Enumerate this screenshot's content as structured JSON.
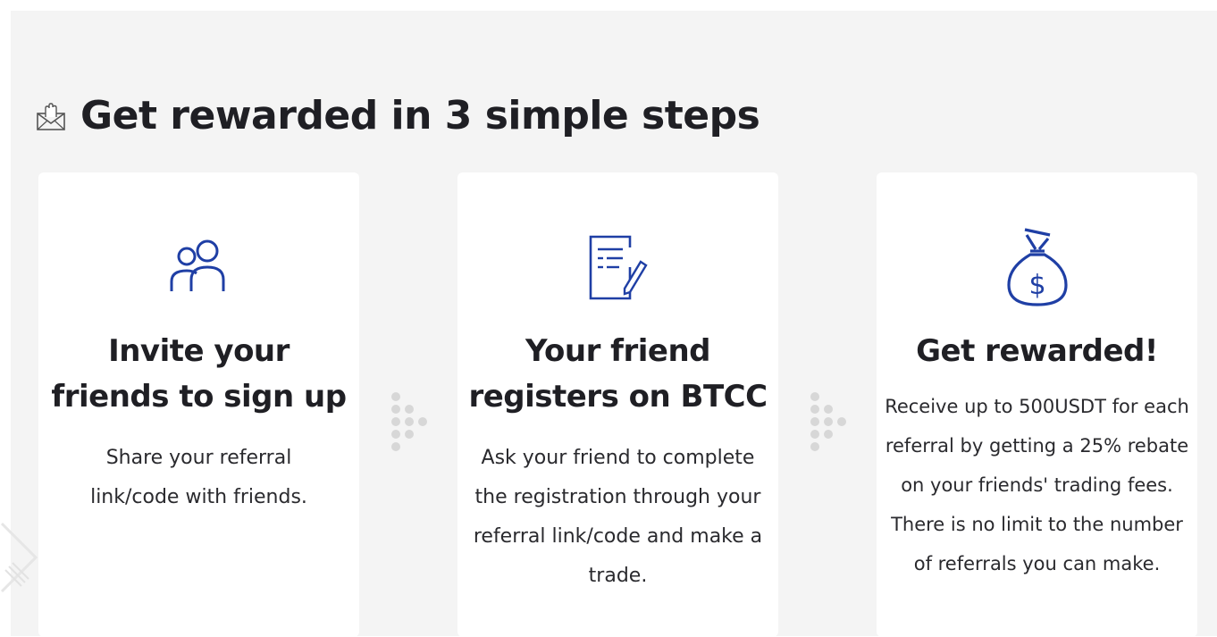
{
  "section": {
    "title": "Get rewarded in 3 simple steps",
    "title_icon": "hand-envelope-icon"
  },
  "colors": {
    "background": "#f4f4f4",
    "card": "#ffffff",
    "icon_blue": "#1f3fa5",
    "dots": "#d7d7d7",
    "text": "#1f1f24"
  },
  "steps": [
    {
      "icon": "users-icon",
      "title": "Invite your friends to sign up",
      "description": "Share your referral link/code with friends."
    },
    {
      "icon": "document-pen-icon",
      "title": "Your friend registers on BTCC",
      "description": "Ask your friend to complete the registration through your referral link/code and make a trade."
    },
    {
      "icon": "money-bag-icon",
      "title": "Get rewarded!",
      "description": "Receive up to 500USDT for each referral by getting a 25% rebate on your friends' trading fees. There is no limit to the number of referrals you can make."
    }
  ]
}
